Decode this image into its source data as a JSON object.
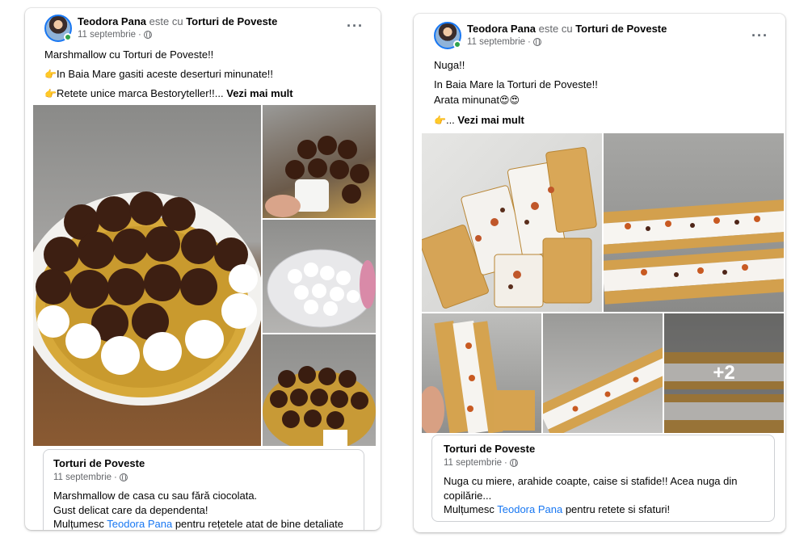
{
  "left_post": {
    "author": "Teodora Pana",
    "connector": "este cu",
    "with_page": "Torturi de Poveste",
    "date": "11 septembrie",
    "more_icon": "ellipsis-icon",
    "line1": "Marshmallow cu Torturi de Poveste!!",
    "line2_icon": "pointing-hand-emoji",
    "line2_emoji": "👉",
    "line2": "In Baia Mare gasiti aceste deserturi minunate!!",
    "line3_emoji": "👉",
    "line3": "Retete unice marca Bestoryteller!!...",
    "see_more": "Vezi mai mult",
    "shared": {
      "name": "Torturi de Poveste",
      "date": "11 septembrie",
      "text1": "Marshmallow de casa cu sau fără ciocolata.",
      "text2": "Gust delicat care da dependenta!",
      "thanks": "Mulțumesc",
      "mention": "Teodora Pana",
      "rest": "pentru rețetele atat de bine detaliate de"
    }
  },
  "right_post": {
    "author": "Teodora Pana",
    "connector": "este cu",
    "with_page": "Torturi de Poveste",
    "date": "11 septembrie",
    "line1": "Nuga!!",
    "line2": "In Baia Mare la Torturi de Poveste!!",
    "line3": "Arata minunat",
    "line3_emoji": "😍😍",
    "line4_emoji": "👉",
    "line4": "...",
    "see_more": "Vezi mai mult",
    "more_photos": "+2",
    "shared": {
      "name": "Torturi de Poveste",
      "date": "11 septembrie",
      "text1": "Nuga cu miere, arahide coapte, caise si stafide!! Acea nuga din copilărie...",
      "thanks": "Mulțumesc",
      "mention": "Teodora Pana",
      "rest": "pentru retete si sfaturi!"
    }
  },
  "colors": {
    "link": "#1877f2",
    "muted": "#65676b",
    "online": "#31a24c"
  }
}
